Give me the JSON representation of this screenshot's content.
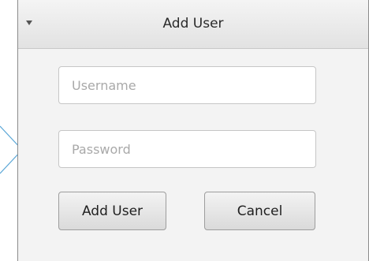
{
  "panel": {
    "title": "Add User",
    "collapse_icon": "triangle-down-icon"
  },
  "form": {
    "username_placeholder": "Username",
    "password_placeholder": "Password",
    "add_label": "Add User",
    "cancel_label": "Cancel"
  },
  "decor": {
    "pointer_icon": "chevron-right-icon"
  }
}
